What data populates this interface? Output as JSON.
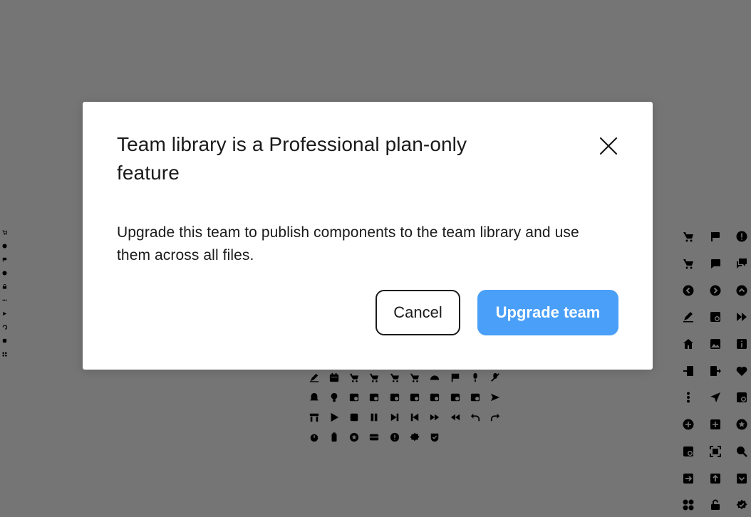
{
  "dialog": {
    "title": "Team library is a Professional plan-only feature",
    "message": "Upgrade this team to publish components to the team library and use them across all files.",
    "cancel_label": "Cancel",
    "upgrade_label": "Upgrade team",
    "close_icon": "close-icon"
  },
  "colors": {
    "backdrop": "#757575",
    "dialog_background": "#ffffff",
    "primary_button": "#4a9ff8",
    "text": "#1a1a1a"
  },
  "canvas_icons": {
    "left_column": [
      "cart-icon",
      "circle-icon",
      "flag-icon",
      "clock-icon",
      "lock-icon",
      "ellipsis-icon",
      "play-icon",
      "undo-icon",
      "box-icon",
      "grid-icon"
    ],
    "center_row_1": [
      "pencil-icon",
      "calendar-icon",
      "cart-icon",
      "cart-add-icon",
      "cart-icon",
      "cart-icon",
      "shell-icon",
      "flag-icon",
      "microphone-icon",
      "microphone-off-icon"
    ],
    "center_row_2": [
      "bell-icon",
      "lightbulb-icon",
      "window-icon",
      "window-icon",
      "window-icon",
      "window-icon",
      "window-icon",
      "window-icon",
      "window-icon",
      "send-icon"
    ],
    "center_row_3": [
      "store-icon",
      "play-icon",
      "stop-icon",
      "pause-icon",
      "skip-next-icon",
      "skip-previous-icon",
      "fast-forward-icon",
      "rewind-icon",
      "undo-icon",
      "redo-icon"
    ],
    "center_row_4": [
      "alarm-icon",
      "battery-icon",
      "star-badge-icon",
      "card-icon",
      "alert-icon",
      "gear-badge-icon",
      "shield-icon"
    ],
    "right_grid": [
      "cart-add-icon",
      "flag-icon",
      "alert-circle-icon",
      "cart-icon",
      "chat-icon",
      "chats-icon",
      "chevron-left-circle-icon",
      "chevron-right-circle-icon",
      "chevron-up-circle-icon",
      "pencil-icon",
      "window-add-icon",
      "fast-forward-icon",
      "home-icon",
      "image-icon",
      "info-icon",
      "login-icon",
      "logout-icon",
      "heart-icon",
      "more-vertical-icon",
      "navigation-icon",
      "window-add-icon",
      "plus-circle-icon",
      "plus-square-icon",
      "star-circle-icon",
      "window-add-icon",
      "scan-icon",
      "search-icon",
      "arrow-right-square-icon",
      "arrow-up-square-icon",
      "chevron-down-square-icon",
      "apps-icon",
      "unlock-icon",
      "gear-badge-icon"
    ]
  }
}
